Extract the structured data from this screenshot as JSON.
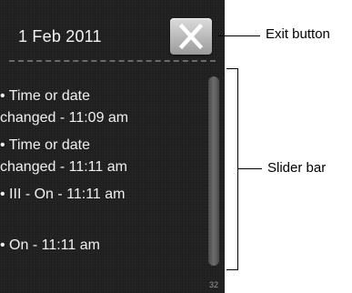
{
  "header": {
    "date": "1 Feb 2011",
    "exit_icon": "close-icon"
  },
  "events": [
    {
      "lines": [
        "• Time or date",
        "changed - 11:09 am"
      ]
    },
    {
      "lines": [
        "• Time or date",
        "changed - 11:11 am"
      ]
    },
    {
      "lines": [
        "• III - On - 11:11 am"
      ]
    },
    {
      "lines": [
        "• On - 11:11 am"
      ]
    }
  ],
  "footer": {
    "page_number": "32"
  },
  "callouts": {
    "exit_button": "Exit button",
    "slider_bar": "Slider bar"
  },
  "colors": {
    "panel_background": "#1f1f1f",
    "text": "#f0f0f0",
    "scrollbar": "#5c5c5c"
  }
}
